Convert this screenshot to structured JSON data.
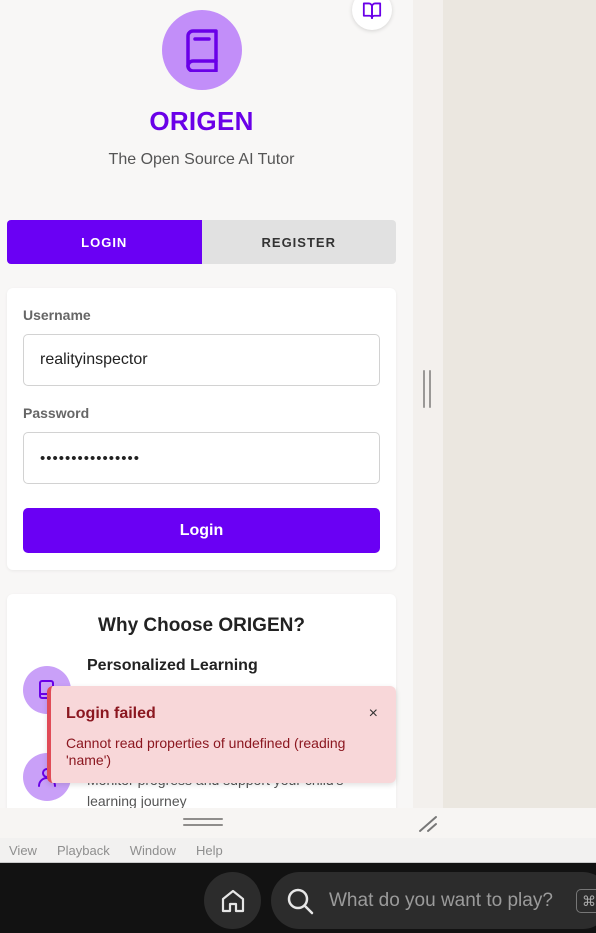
{
  "brand": {
    "name": "ORIGEN",
    "tagline": "The Open Source AI Tutor"
  },
  "auth_tabs": {
    "login": "LOGIN",
    "register": "REGISTER",
    "active": "login"
  },
  "login_form": {
    "username_label": "Username",
    "username_value": "realityinspector",
    "password_label": "Password",
    "password_value": "••••••••••••••••",
    "submit_label": "Login"
  },
  "why_section": {
    "title": "Why Choose ORIGEN?",
    "features": [
      {
        "title": "Personalized Learning",
        "icon": "tablet-icon"
      },
      {
        "description": "Monitor progress and support your child's learning journey",
        "icon": "user-icon"
      }
    ]
  },
  "toast": {
    "title": "Login failed",
    "message": "Cannot read properties of undefined (reading 'name')",
    "close_symbol": "×"
  },
  "menubar": {
    "items": [
      "View",
      "Playback",
      "Window",
      "Help"
    ]
  },
  "taskbar": {
    "search_placeholder": "What do you want to play?",
    "shortcut_symbol": "⌘"
  },
  "colors": {
    "brand_purple": "#6a00f4",
    "logo_bg": "#c28ef9",
    "error_bg": "#f8d7d9",
    "error_text": "#8b1720"
  }
}
